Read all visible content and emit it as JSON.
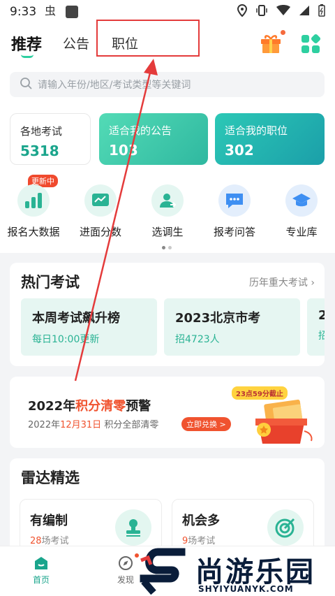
{
  "status_bar": {
    "time": "9:33"
  },
  "header": {
    "tabs": [
      {
        "label": "推荐",
        "active": true
      },
      {
        "label": "公告",
        "active": false
      },
      {
        "label": "职位",
        "active": false
      }
    ]
  },
  "search": {
    "placeholder": "请输入年份/地区/考试类型等关键词"
  },
  "stats": [
    {
      "label": "各地考试",
      "value": "5318"
    },
    {
      "label": "适合我的公告",
      "value": "103"
    },
    {
      "label": "适合我的职位",
      "value": "302"
    }
  ],
  "quick_actions": {
    "badge": "更新中",
    "items": [
      {
        "label": "报名大数据",
        "icon": "bar-chart-icon"
      },
      {
        "label": "进面分数",
        "icon": "line-chart-icon"
      },
      {
        "label": "选调生",
        "icon": "person-swap-icon"
      },
      {
        "label": "报考问答",
        "icon": "chat-bubble-icon"
      },
      {
        "label": "专业库",
        "icon": "graduation-cap-icon"
      }
    ]
  },
  "hot_exams": {
    "title": "热门考试",
    "more": "历年重大考试",
    "items": [
      {
        "title": "本周考试飙升榜",
        "sub": "每日10:00更新"
      },
      {
        "title": "2023北京市考",
        "sub": "招4723人"
      },
      {
        "title": "2",
        "sub": "招"
      }
    ]
  },
  "warning": {
    "title_pre": "2022年",
    "title_red": "积分清零",
    "title_post": "预警",
    "sub_pre": "2022年",
    "sub_red": "12月31日",
    "sub_post": "积分全部清零",
    "button": "立即兑换 >",
    "badge": "23点59分截止"
  },
  "radar": {
    "title": "雷达精选",
    "items": [
      {
        "title": "有编制",
        "count": "28",
        "count_suffix": "场考试"
      },
      {
        "title": "机会多",
        "count": "9",
        "count_suffix": "场考试"
      }
    ]
  },
  "bottom_nav": {
    "items": [
      {
        "label": "首页"
      },
      {
        "label": "发现"
      }
    ]
  },
  "watermark": {
    "text": "尚游乐园",
    "url": "SHYIYUANYK.COM"
  },
  "colors": {
    "accent": "#2ecfa0",
    "teal": "#1aa58c",
    "red": "#f0532f",
    "annotation": "#e43b3b"
  }
}
